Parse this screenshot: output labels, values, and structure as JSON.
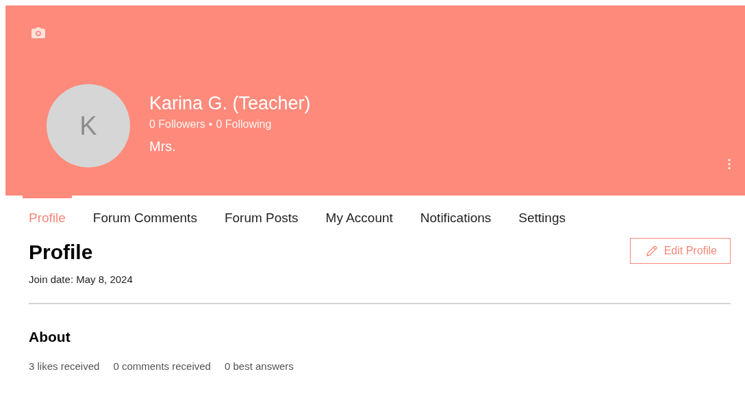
{
  "header": {
    "avatar_letter": "K",
    "name": "Karina G. (Teacher)",
    "followers": "0 Followers",
    "separator": "•",
    "following": "0 Following",
    "title": "Mrs."
  },
  "tabs": [
    {
      "label": "Profile",
      "selected": true
    },
    {
      "label": "Forum Comments",
      "selected": false
    },
    {
      "label": "Forum Posts",
      "selected": false
    },
    {
      "label": "My Account",
      "selected": false
    },
    {
      "label": "Notifications",
      "selected": false
    },
    {
      "label": "Settings",
      "selected": false
    }
  ],
  "profile": {
    "heading": "Profile",
    "edit_button": "Edit Profile",
    "join_date": "Join date: May 8, 2024"
  },
  "about": {
    "heading": "About",
    "stats": [
      "3 likes received",
      "0 comments received",
      "0 best answers"
    ]
  }
}
